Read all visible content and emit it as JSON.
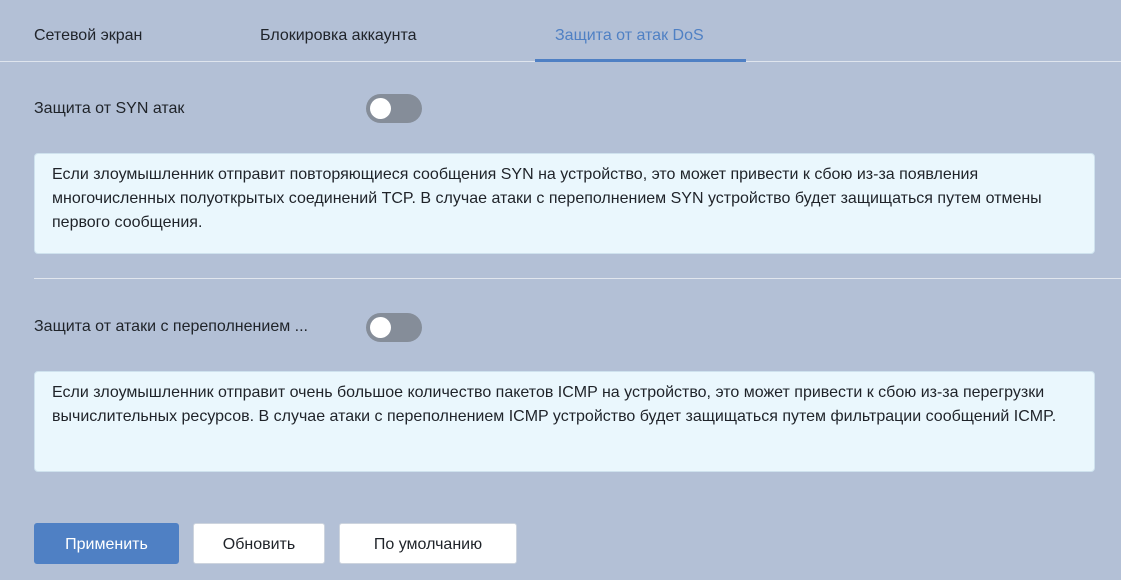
{
  "tabs": [
    {
      "label": "Сетевой экран",
      "active": false
    },
    {
      "label": "Блокировка аккаунта",
      "active": false
    },
    {
      "label": "Защита от атак DoS",
      "active": true
    }
  ],
  "syn": {
    "label": "Защита от SYN атак",
    "enabled": false,
    "description": "Если злоумышленник отправит повторяющиеся сообщения SYN на устройство, это может привести к сбою из-за появления многочисленных полуоткрытых соединений TCP. В случае атаки с переполнением SYN устройство будет защищаться путем отмены первого сообщения."
  },
  "icmp": {
    "label": "Защита от атаки с переполнением ...",
    "enabled": false,
    "description": "Если злоумышленник отправит очень большое количество пакетов ICMP на устройство, это может привести к сбою из-за перегрузки вычислительных ресурсов. В случае атаки с переполнением ICMP устройство будет защищаться путем фильтрации сообщений ICMP."
  },
  "buttons": {
    "apply": "Применить",
    "refresh": "Обновить",
    "default": "По умолчанию"
  },
  "colors": {
    "accent": "#4f80c4",
    "background": "#b3c0d6",
    "info_bg": "#eaf7fd",
    "toggle_off": "#858d99"
  }
}
